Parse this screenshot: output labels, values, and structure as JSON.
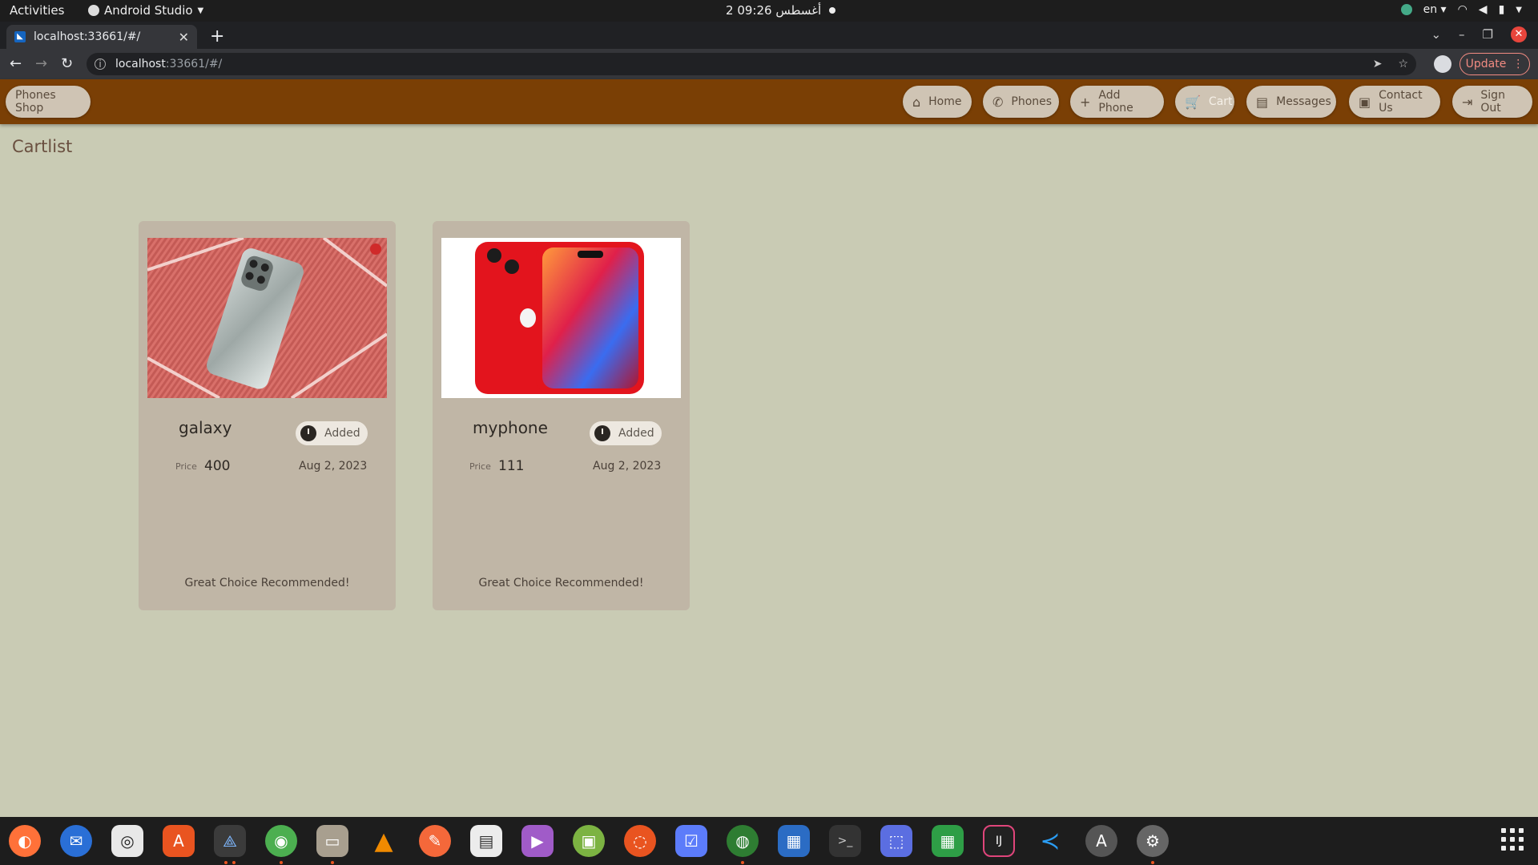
{
  "system_bar": {
    "activities": "Activities",
    "app_name": "Android Studio",
    "clock": "2 أغسطس 09:26",
    "language": "en"
  },
  "browser": {
    "tab_title": "localhost:33661/#/",
    "url_host": "localhost",
    "url_rest": ":33661/#/",
    "update_label": "Update"
  },
  "app": {
    "brand": "Phones Shop",
    "nav": [
      {
        "label": "Home",
        "icon": "home-icon"
      },
      {
        "label": "Phones",
        "icon": "phone-icon"
      },
      {
        "label": "Add Phone",
        "icon": "plus-icon"
      },
      {
        "label": "Cart",
        "icon": "cart-icon"
      },
      {
        "label": "Messages",
        "icon": "message-icon"
      },
      {
        "label": "Contact Us",
        "icon": "contact-icon"
      },
      {
        "label": "Sign Out",
        "icon": "sign-out-icon"
      }
    ],
    "active_nav": "Cart",
    "page_title": "Cartlist",
    "price_label": "Price",
    "cards": [
      {
        "name": "galaxy",
        "chip": "Added",
        "price": "400",
        "date": "Aug 2, 2023",
        "note": "Great Choice Recommended!"
      },
      {
        "name": "myphone",
        "chip": "Added",
        "price": "111",
        "date": "Aug 2, 2023",
        "note": "Great Choice Recommended!"
      }
    ]
  },
  "colors": {
    "appbar": "#7a3f05",
    "background": "#c9cbb4",
    "card": "#c0b6a6",
    "pill": "#cfc4b4"
  },
  "dock": [
    "firefox-icon",
    "thunderbird-icon",
    "rhythmbox-icon",
    "software-center-icon",
    "android-studio-icon",
    "chrome-icon",
    "files-icon",
    "vlc-icon",
    "pen-icon",
    "document-viewer-icon",
    "video-icon",
    "android-icon",
    "ubuntu-icon",
    "tasks-icon",
    "globe-icon",
    "writer-icon",
    "terminal-icon",
    "screenshot-icon",
    "calc-icon",
    "intellij-icon",
    "vscode-icon",
    "updater-icon",
    "settings-icon"
  ]
}
